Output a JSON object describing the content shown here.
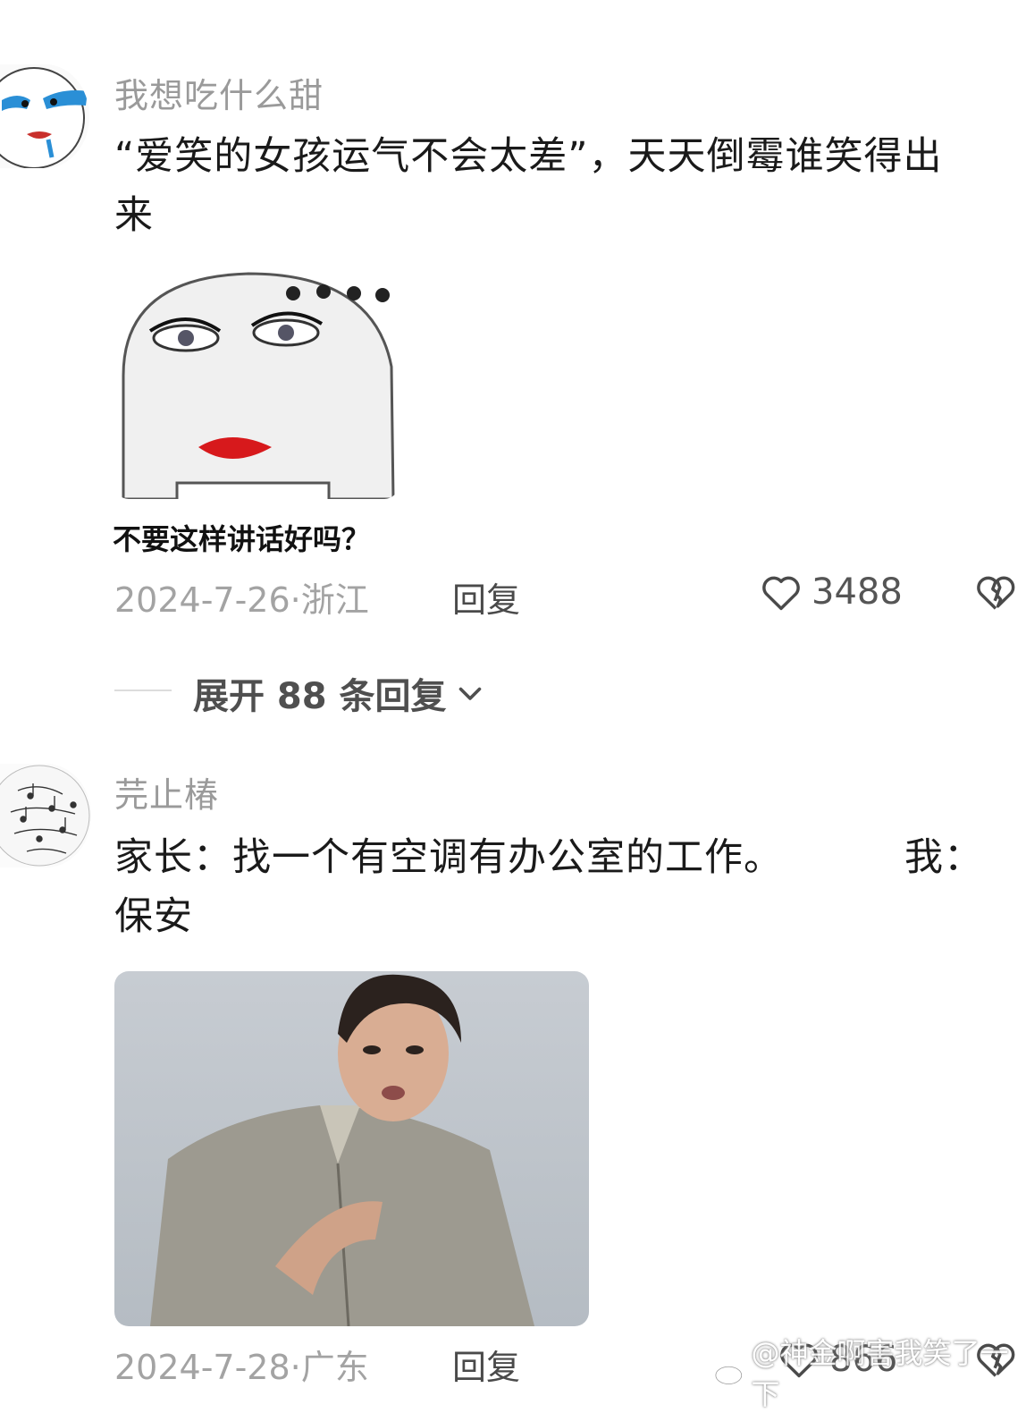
{
  "comments": [
    {
      "username": "我想吃什么甜",
      "text_line1": "“爱笑的女孩运气不会太差”，天天倒霉谁笑得出",
      "text_line2": "来",
      "meme_caption": "不要这样讲话好吗？",
      "date": "2024-7-26",
      "location": "浙江",
      "reply_label": "回复",
      "likes": "3488"
    },
    {
      "username": "芫止椿",
      "text_line1": "家长：找一个有空调有办公室的工作。",
      "text_line1_tail": "我：",
      "text_line2": "保安",
      "date": "2024-7-28",
      "location": "广东",
      "reply_label": "回复",
      "likes": "866"
    }
  ],
  "expand": {
    "label": "展开 88 条回复"
  },
  "watermark": "@神金啊害我笑了一下",
  "icons": {
    "like": "heart-outline-icon",
    "dislike": "broken-heart-icon",
    "expand": "chevron-down-icon"
  },
  "colors": {
    "meta": "#a3a3a3",
    "text": "#1a1a1a"
  }
}
